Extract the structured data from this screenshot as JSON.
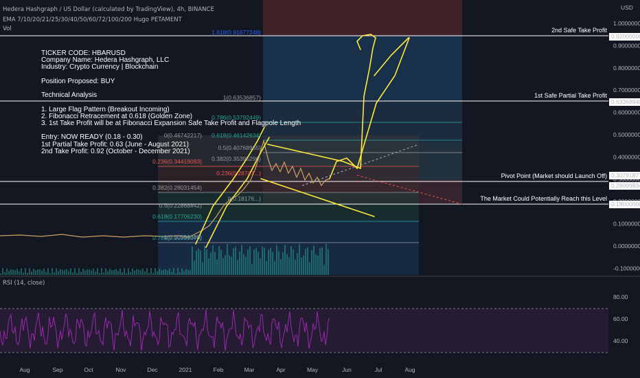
{
  "header": {
    "title": "Hedera Hashgraph / US Dollar (calculated by TradingView), 4h, BINANCE",
    "indicators": "EMA 7/10/20/21/25/30/40/50/60/72/100/200 Hugo PETAMENT",
    "volume": "Vol",
    "currency": "USD",
    "rsi_label": "RSI (14, close)"
  },
  "notes": [
    "TICKER CODE: HBARUSD",
    "Company Name: Hedera Hashgraph, LLC",
    "Industry: Crypto Currency | Blockchain",
    "",
    "Position Proposed: BUY",
    "",
    "Technical Analysis",
    "",
    "1. Large Flag Pattern (Breakout Incoming)",
    "2. Fibonacci Retracement at 0.618 (Golden Zone)",
    "3. 1st Take Profit will be at Fibonacci Expansion Safe Take Profit and Flagpole Length",
    "",
    "Entry: NOW READY (0.18 - 0.30)",
    "1st Partial Take Profit: 0.63 (June - August 2021)",
    "2nd Take Profit: 0.92 (October - December 2021)"
  ],
  "annotations": {
    "take2": "2nd Safe Take Profit",
    "take1": "1st Safe Partial Take Profit",
    "pivot": "Pivot Point (Market should Launch Off)",
    "reach": "The Market Could Potentially Reach this Level"
  },
  "price_axis": [
    "1.00000000",
    "0.90000000",
    "0.80000000",
    "0.70000000",
    "0.60000000",
    "0.50000000",
    "0.40000000",
    "0.30000000",
    "0.20000000",
    "0.10000000",
    "0.00000000",
    "-0.10000000"
  ],
  "price_tags": [
    "0.92000000",
    "0.63368940",
    "0.30791877",
    "0.28099934",
    "0.18000000"
  ],
  "rsi_axis": [
    "80.00",
    "60.00",
    "40.00"
  ],
  "time_axis": [
    "Aug",
    "Sep",
    "Oct",
    "Nov",
    "Dec",
    "2021",
    "Feb",
    "Mar",
    "Apr",
    "May",
    "Jun",
    "Jul",
    "Aug"
  ],
  "fib_expansion": [
    "1.618(0.91677248)",
    "1(0.63536857)",
    "0.786(0.53792449)",
    "0.618(0.46142634)",
    "0.5(0.40768965)",
    "0.382(0.35395296)",
    "0.236(0.28747...)",
    "0(0.18176...)"
  ],
  "fib_retracement": [
    "0(0.46742217)",
    "0.236(0.34419093)",
    "0.382(0.28031454)",
    "0.5(0.22868842)",
    "0.618(0.17706230)",
    "0.786(0.10356070)",
    "1(0.00959380)"
  ],
  "colors": {
    "bg": "#131722",
    "purple": "#9c27b0",
    "yellow": "#ffeb3b",
    "red": "#ef5350",
    "teal": "#26a69a",
    "blue": "#2962ff"
  }
}
